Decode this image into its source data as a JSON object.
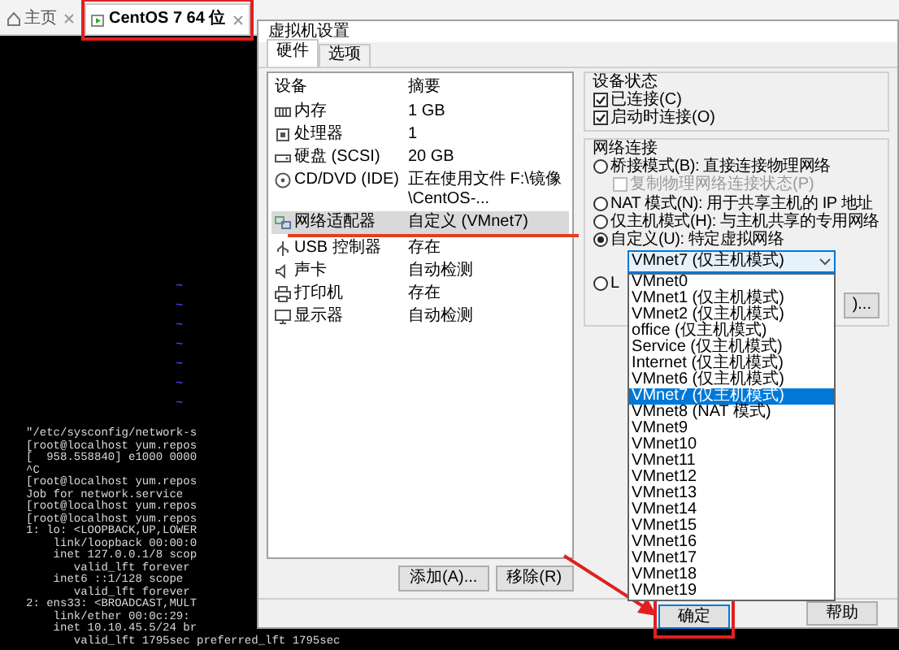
{
  "app_tabs": [
    {
      "label": "主页",
      "selected": false
    },
    {
      "label": "CentOS 7 64 位",
      "selected": true
    }
  ],
  "terminal": {
    "tildes": [
      "~",
      "~",
      "~",
      "~",
      "~",
      "~",
      "~"
    ],
    "lines": [
      "\"/etc/sysconfig/network-s",
      "[root@localhost yum.repos",
      "[  958.558840] e1000 0000",
      "^C",
      "[root@localhost yum.repos",
      "Job for network.service",
      "[root@localhost yum.repos",
      "[root@localhost yum.repos",
      "1: lo: <LOOPBACK,UP,LOWER",
      "    link/loopback 00:00:0",
      "    inet 127.0.0.1/8 scop",
      "       valid_lft forever",
      "    inet6 ::1/128 scope",
      "       valid_lft forever",
      "2: ens33: <BROADCAST,MULT",
      "    link/ether 00:0c:29:",
      "    inet 10.10.45.5/24 br",
      "       valid_lft 1795sec preferred_lft 1795sec"
    ]
  },
  "dialog": {
    "title": "虚拟机设置",
    "tabs": [
      {
        "label": "硬件",
        "selected": true
      },
      {
        "label": "选项",
        "selected": false
      }
    ],
    "devices": {
      "columns": [
        "设备",
        "摘要"
      ],
      "rows": [
        {
          "device": "内存",
          "summary": "1 GB",
          "selected": false
        },
        {
          "device": "处理器",
          "summary": "1",
          "selected": false
        },
        {
          "device": "硬盘 (SCSI)",
          "summary": "20 GB",
          "selected": false
        },
        {
          "device": "CD/DVD (IDE)",
          "summary": "正在使用文件 F:\\镜像\\CentOS-...",
          "selected": false
        },
        {
          "device": "网络适配器",
          "summary": "自定义 (VMnet7)",
          "selected": true
        },
        {
          "device": "USB 控制器",
          "summary": "存在",
          "selected": false
        },
        {
          "device": "声卡",
          "summary": "自动检测",
          "selected": false
        },
        {
          "device": "打印机",
          "summary": "存在",
          "selected": false
        },
        {
          "device": "显示器",
          "summary": "自动检测",
          "selected": false
        }
      ]
    },
    "device_buttons": [
      "添加(A)...",
      "移除(R)"
    ],
    "device_status": {
      "title": "设备状态",
      "options": [
        {
          "label": "已连接(C)",
          "checked": true
        },
        {
          "label": "启动时连接(O)",
          "checked": true
        }
      ]
    },
    "network": {
      "title": "网络连接",
      "options": [
        {
          "kind": "radio",
          "label": "桥接模式(B): 直接连接物理网络",
          "selected": false
        },
        {
          "kind": "checkbox",
          "label": "复制物理网络连接状态(P)",
          "checked": false,
          "disabled": true
        },
        {
          "kind": "radio",
          "label": "NAT 模式(N): 用于共享主机的 IP 地址",
          "selected": false
        },
        {
          "kind": "radio",
          "label": "仅主机模式(H): 与主机共享的专用网络",
          "selected": false
        },
        {
          "kind": "radio",
          "label": "自定义(U): 特定虚拟网络",
          "selected": true
        },
        {
          "kind": "dropdown",
          "value": "VMnet7 (仅主机模式)",
          "expanded": true,
          "items": [
            {
              "label": "VMnet0",
              "selected": false
            },
            {
              "label": "VMnet1 (仅主机模式)",
              "selected": false
            },
            {
              "label": "VMnet2 (仅主机模式)",
              "selected": false
            },
            {
              "label": "office (仅主机模式)",
              "selected": false
            },
            {
              "label": "Service (仅主机模式)",
              "selected": false
            },
            {
              "label": "Internet (仅主机模式)",
              "selected": false
            },
            {
              "label": "VMnet6 (仅主机模式)",
              "selected": false
            },
            {
              "label": "VMnet7 (仅主机模式)",
              "selected": true
            },
            {
              "label": "VMnet8 (NAT 模式)",
              "selected": false
            },
            {
              "label": "VMnet9",
              "selected": false
            },
            {
              "label": "VMnet10",
              "selected": false
            },
            {
              "label": "VMnet11",
              "selected": false
            },
            {
              "label": "VMnet12",
              "selected": false
            },
            {
              "label": "VMnet13",
              "selected": false
            },
            {
              "label": "VMnet14",
              "selected": false
            },
            {
              "label": "VMnet15",
              "selected": false
            },
            {
              "label": "VMnet16",
              "selected": false
            },
            {
              "label": "VMnet17",
              "selected": false
            },
            {
              "label": "VMnet18",
              "selected": false
            },
            {
              "label": "VMnet19",
              "selected": false
            }
          ]
        },
        {
          "kind": "radio",
          "label": "L",
          "selected": false
        },
        {
          "kind": "button",
          "label": ")..."
        }
      ]
    },
    "buttons": [
      "确定",
      "帮助"
    ]
  }
}
